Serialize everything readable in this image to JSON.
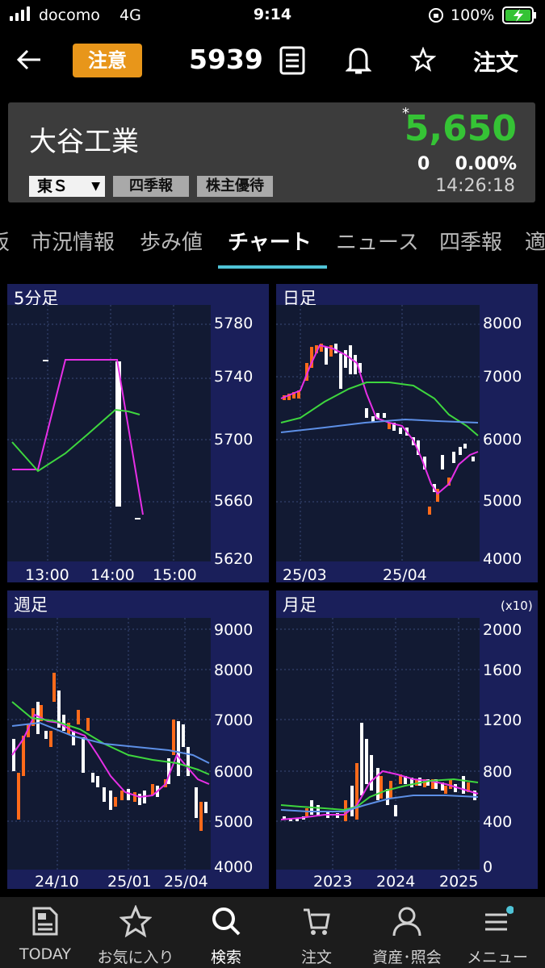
{
  "status": {
    "carrier": "docomo",
    "network": "4G",
    "time": "9:14",
    "battery": "100%"
  },
  "header": {
    "caution_label": "注意",
    "code": "5939",
    "order_label": "注文"
  },
  "stock": {
    "name": "大谷工業",
    "market": "東Ｓ",
    "tags": [
      "四季報",
      "株主優待"
    ],
    "asterisk": "*",
    "price": "5,650",
    "change": "0",
    "change_pct": "0.00%",
    "time": "14:26:18",
    "price_color": "#35c335"
  },
  "tabs": [
    "市況情報",
    "歩み値",
    "チャート",
    "ニュース",
    "四季報",
    "適"
  ],
  "active_tab": "チャート",
  "charts": {
    "min5": {
      "title": "5分足",
      "yticks": [
        "5780",
        "5740",
        "5700",
        "5660",
        "5620"
      ],
      "xticks": [
        "13:00",
        "14:00",
        "15:00"
      ]
    },
    "daily": {
      "title": "日足",
      "yticks": [
        "8000",
        "7000",
        "6000",
        "5000",
        "4000"
      ],
      "xticks": [
        "25/03",
        "25/04"
      ]
    },
    "weekly": {
      "title": "週足",
      "yticks": [
        "9000",
        "8000",
        "7000",
        "6000",
        "5000",
        "4000"
      ],
      "xticks": [
        "24/10",
        "25/01",
        "25/04"
      ]
    },
    "monthly": {
      "title": "月足",
      "unit": "(x10)",
      "yticks": [
        "2000",
        "1600",
        "1200",
        "800",
        "400",
        "0"
      ],
      "xticks": [
        "2023",
        "2024",
        "2025"
      ]
    }
  },
  "nav": [
    {
      "label": "TODAY",
      "icon": "news-icon"
    },
    {
      "label": "お気に入り",
      "icon": "star-icon"
    },
    {
      "label": "検索",
      "icon": "search-icon"
    },
    {
      "label": "注文",
      "icon": "cart-icon"
    },
    {
      "label": "資産･照会",
      "icon": "person-icon"
    },
    {
      "label": "メニュー",
      "icon": "menu-icon"
    }
  ],
  "colors": {
    "accent": "#4fc3d6",
    "caution": "#e8961a",
    "up": "#ff6a1a",
    "down": "#ffffff",
    "ma_short": "#e62fe6",
    "ma_mid": "#3ed63e",
    "ma_long": "#5d8fe6"
  }
}
